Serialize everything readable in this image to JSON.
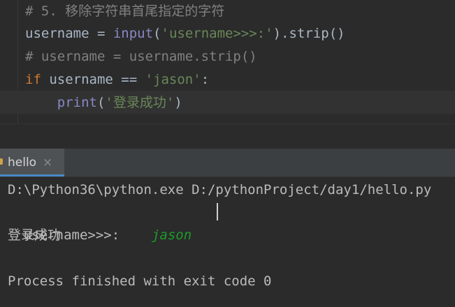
{
  "editor": {
    "lines": [
      [
        {
          "t": "# 5. 移除字符串首尾指定的字符",
          "c": "comment"
        }
      ],
      [
        {
          "t": "username = ",
          "c": "plain"
        },
        {
          "t": "input",
          "c": "builtin"
        },
        {
          "t": "(",
          "c": "plain"
        },
        {
          "t": "'username>>>:'",
          "c": "string"
        },
        {
          "t": ").strip()",
          "c": "plain"
        }
      ],
      [
        {
          "t": "# username = username.strip()",
          "c": "comment"
        }
      ],
      [
        {
          "t": "if ",
          "c": "keyword"
        },
        {
          "t": "username == ",
          "c": "plain"
        },
        {
          "t": "'jason'",
          "c": "string"
        },
        {
          "t": ":",
          "c": "plain"
        }
      ],
      [
        {
          "t": "    ",
          "c": "plain"
        },
        {
          "t": "print",
          "c": "builtin"
        },
        {
          "t": "(",
          "c": "plain"
        },
        {
          "t": "'登录成功'",
          "c": "string"
        },
        {
          "t": ")",
          "c": "plain"
        }
      ]
    ]
  },
  "run_panel": {
    "tab_label": "hello",
    "tab_close": "×"
  },
  "console": {
    "command": "D:\\Python36\\python.exe D:/pythonProject/day1/hello.py",
    "prompt": "username>>>:",
    "user_input": "jason",
    "output": "登录成功",
    "exit_message": "Process finished with exit code 0"
  },
  "colors": {
    "background": "#2b2b2b",
    "comment": "#808080",
    "string": "#6a8759",
    "keyword": "#cc7832",
    "builtin": "#8888c6",
    "plain": "#a9b7c6",
    "console_input": "#1d9a2a",
    "tab_indicator": "#4a88c7"
  }
}
